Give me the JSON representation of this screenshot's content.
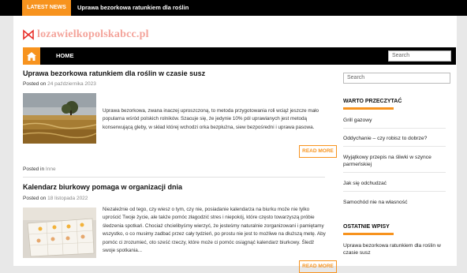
{
  "ticker": {
    "label": "LATEST NEWS",
    "text": "Uprawa bezorkowa ratunkiem dla roślin"
  },
  "site": {
    "logo_text": "lozawielkopolskabcc.pl",
    "logo_icon": "bow-tie-logo-icon"
  },
  "nav": {
    "home_icon": "home-icon",
    "home_label": "HOME",
    "search_placeholder": "Search"
  },
  "posts": [
    {
      "title": "Uprawa bezorkowa ratunkiem dla roślin w czasie susz",
      "posted_on_label": "Posted on",
      "date": "24 października 2023",
      "excerpt": "Uprawa bezorkowa, zwana inaczej uproszczoną, to metoda przygotowania roli wciąż jeszcze mało popularna wśród polskich rolników. Szacuje się, że jedynie 10% pól uprawianych jest metodą konserwującą gleby, w skład której wchodzi orka bezpłużna, siew bezpośredni i uprawa pasowa.",
      "read_more": "READ MORE",
      "posted_in_label": "Posted in",
      "category": "Inne"
    },
    {
      "title": "Kalendarz biurkowy pomaga w organizacji dnia",
      "posted_on_label": "Posted on",
      "date": "18 listopada 2022",
      "excerpt": "Niezależnie od tego, czy wiesz o tym, czy nie, posiadanie kalendarza na biurku może nie tylko uprościć Twoje życie, ale także pomóc złagodzić stres i niepokój, które często towarzyszą próbie śledzenia spotkań. Chociaż chcielibyśmy wierzyć, że jesteśmy naturalnie zorganizowani i pamiętamy wszystko, o co musimy zadbać przez cały tydzień, po prostu nie jest to możliwe na dłuższą metę. Aby pomóc ci zrozumieć, oto sześć rzeczy, które może ci pomóc osiągnąć kalendarz biurkowy. Śledź swoje spotkania...",
      "read_more": "READ MORE"
    }
  ],
  "sidebar": {
    "search_placeholder": "Search",
    "worth_reading": {
      "title": "WARTO PRZECZYTAĆ",
      "items": [
        "Grill gazowy",
        "Oddychanie – czy robisz to dobrze?",
        "Wyjątkowy przepis na śliwki w szynce parmeńskiej",
        "Jak się odchudzać",
        "Samochód nie na własność"
      ]
    },
    "recent_posts": {
      "title": "OSTATNIE WPISY",
      "items": [
        "Uprawa bezorkowa ratunkiem dla roślin w czasie susz"
      ]
    }
  },
  "colors": {
    "accent": "#f7931e",
    "logo": "#f4a49b",
    "bar": "#000000",
    "background": "#e8e8e8"
  }
}
